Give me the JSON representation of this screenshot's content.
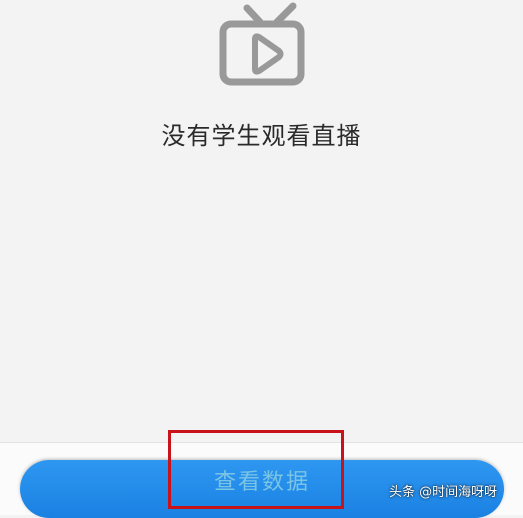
{
  "empty_state": {
    "icon": "tv-play-icon",
    "message": "没有学生观看直播"
  },
  "footer": {
    "button_label": "查看数据"
  },
  "watermark": {
    "text": "头条 @时间海呀呀"
  },
  "colors": {
    "background": "#f3f3f3",
    "icon": "#999999",
    "button": "#1a81e2",
    "button_text": "#7bc5e4",
    "highlight": "#c9131b"
  }
}
